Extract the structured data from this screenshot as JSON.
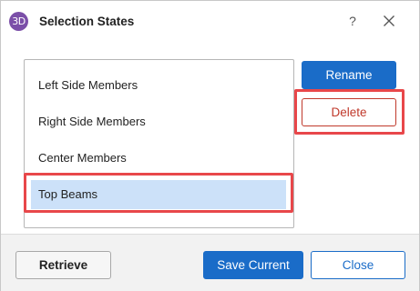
{
  "window": {
    "title": "Selection States",
    "app_icon_text": "3D",
    "help_label": "?"
  },
  "list": {
    "items": [
      {
        "label": "Left Side Members",
        "selected": false
      },
      {
        "label": "Right Side Members",
        "selected": false
      },
      {
        "label": "Center Members",
        "selected": false
      },
      {
        "label": "Top Beams",
        "selected": true
      }
    ]
  },
  "side_buttons": {
    "rename_label": "Rename",
    "delete_label": "Delete"
  },
  "footer": {
    "retrieve_label": "Retrieve",
    "save_label": "Save Current",
    "close_label": "Close"
  },
  "colors": {
    "accent": "#1a6cc8",
    "danger": "#c0392b",
    "highlight": "#e8474a",
    "selection": "#cce1f9",
    "app_icon": "#7b4fa8"
  }
}
